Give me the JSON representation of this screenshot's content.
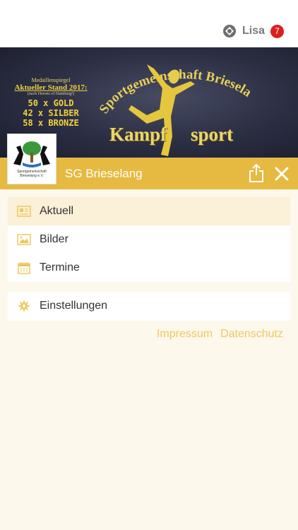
{
  "user": {
    "name": "Lisa",
    "badge_count": "7"
  },
  "banner": {
    "arc_text": "Sportgemeinschaft Brieselang e.V.",
    "medal_title": "Medaillenspiegel",
    "medal_stand": "Aktueller Stand 2017:",
    "medal_sub": "(nach Heroes of Hamburg²)",
    "medals": [
      "50 x GOLD",
      "42 x SILBER",
      "58 x BRONZE"
    ],
    "kampf_left": "Kampf",
    "kampf_right": "sport"
  },
  "club_logo": {
    "line1": "Sportgemeinschaft",
    "line2": "Brieselang e.V."
  },
  "header": {
    "title": "SG Brieselang"
  },
  "menu": {
    "items": [
      {
        "label": "Aktuell",
        "icon": "news-icon",
        "active": true
      },
      {
        "label": "Bilder",
        "icon": "image-icon",
        "active": false
      },
      {
        "label": "Termine",
        "icon": "calendar-icon",
        "active": false
      }
    ],
    "settings": {
      "label": "Einstellungen",
      "icon": "gear-icon"
    }
  },
  "footer": {
    "impressum": "Impressum",
    "datenschutz": "Datenschutz"
  },
  "colors": {
    "accent": "#e6b941",
    "active_row": "#fbf0d8",
    "background": "#fdf8ec",
    "badge": "#d9201f"
  }
}
